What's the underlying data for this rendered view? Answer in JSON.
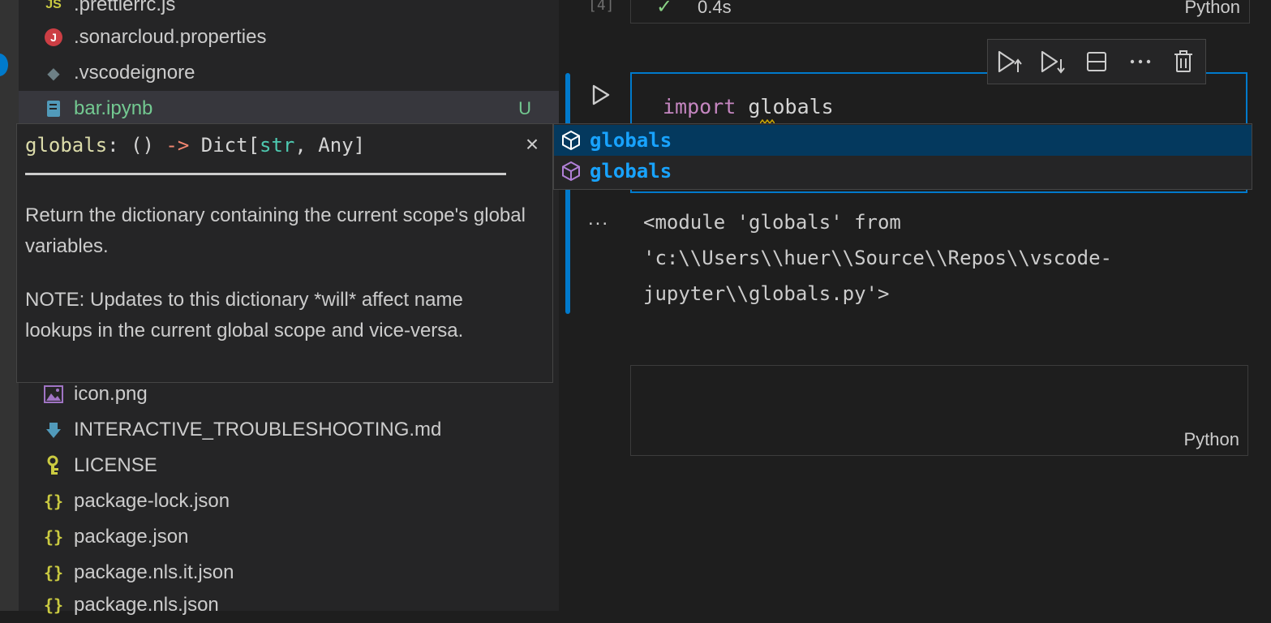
{
  "explorer": {
    "files": [
      {
        "name": ".prettierrc.js",
        "icon": "js-icon",
        "icon_text": "JS",
        "icon_color": "#cbcb41"
      },
      {
        "name": ".sonarcloud.properties",
        "icon": "java-icon",
        "icon_text": "J",
        "icon_color": "#cc3e44"
      },
      {
        "name": ".vscodeignore",
        "icon": "git-icon",
        "icon_text": "◆",
        "icon_color": "#6d8086"
      },
      {
        "name": "bar.ipynb",
        "icon": "notebook-icon",
        "status": "U",
        "selected": true,
        "name_color": "#73c991"
      },
      {
        "name": "icon.png",
        "icon": "image-icon"
      },
      {
        "name": "INTERACTIVE_TROUBLESHOOTING.md",
        "icon": "markdown-icon"
      },
      {
        "name": "LICENSE",
        "icon": "license-icon"
      },
      {
        "name": "package-lock.json",
        "icon": "json-icon",
        "icon_text": "{}",
        "icon_color": "#cbcb41"
      },
      {
        "name": "package.json",
        "icon": "json-icon",
        "icon_text": "{}",
        "icon_color": "#cbcb41"
      },
      {
        "name": "package.nls.it.json",
        "icon": "json-icon",
        "icon_text": "{}",
        "icon_color": "#cbcb41"
      },
      {
        "name": "package.nls.json",
        "icon": "json-icon",
        "icon_text": "{}",
        "icon_color": "#cbcb41"
      }
    ]
  },
  "notebook": {
    "prev_cell": {
      "execution_count": "[4]",
      "duration": "0.4s",
      "language": "Python"
    },
    "active_cell": {
      "code_keyword": "import",
      "code_identifier": "globals",
      "output_ellipsis": "...",
      "output_lines": [
        "<module 'globals' from",
        "'c:\\\\Users\\\\huer\\\\Source\\\\Repos\\\\vscode-",
        "jupyter\\\\globals.py'>"
      ]
    },
    "next_cell": {
      "language": "Python"
    },
    "toolbar": [
      "execute-above-icon",
      "execute-below-icon",
      "split-cell-icon",
      "more-actions-icon",
      "delete-icon"
    ]
  },
  "suggest": {
    "items": [
      {
        "label": "globals",
        "icon": "module-icon",
        "active": true
      },
      {
        "label": "globals",
        "icon": "module-icon",
        "active": false
      }
    ]
  },
  "doc": {
    "signature": {
      "name": "globals",
      "colon": ": ",
      "params": "() ",
      "arrow": "->",
      "ret_prefix": " Dict[",
      "ret_t1": "str",
      "ret_sep": ", ",
      "ret_t2": "Any",
      "ret_suffix": "]"
    },
    "close": "×",
    "paragraph1": "Return the dictionary containing the current scope's global variables.",
    "paragraph2": "NOTE: Updates to this dictionary *will* affect name lookups in the current global scope and vice-versa."
  },
  "colors": {
    "accent": "#007acc",
    "suggest_text": "#18a3ff",
    "untracked": "#73c991"
  }
}
